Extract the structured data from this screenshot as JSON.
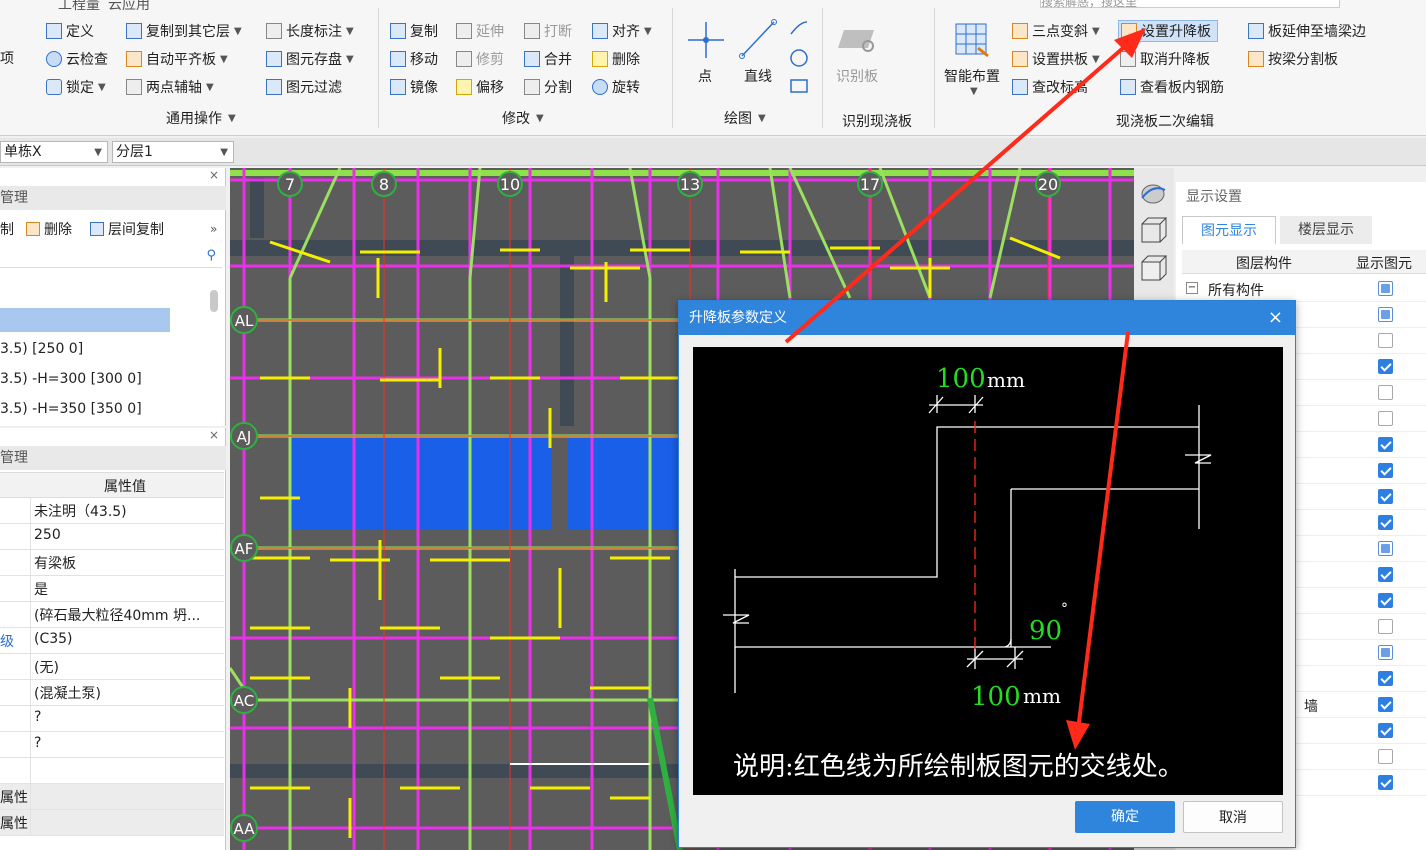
{
  "ribbon": {
    "top_tabs": [
      "工程量",
      "云应用"
    ],
    "group_general": {
      "label": "通用操作",
      "items": [
        "定义",
        "复制到其它层",
        "长度标注",
        "云检查",
        "自动平齐板",
        "图元存盘",
        "锁定",
        "两点辅轴",
        "图元过滤"
      ]
    },
    "group_modify": {
      "label": "修改",
      "items": [
        "复制",
        "延伸",
        "打断",
        "对齐",
        "移动",
        "修剪",
        "合并",
        "删除",
        "镜像",
        "偏移",
        "分割",
        "旋转"
      ]
    },
    "group_draw": {
      "label": "绘图",
      "items": [
        "点",
        "直线"
      ]
    },
    "group_identify": {
      "label": "识别现浇板",
      "items": [
        "识别板"
      ]
    },
    "group_slab": {
      "label": "现浇板二次编辑",
      "items": [
        "智能布置",
        "三点变斜",
        "设置拱板",
        "查改标高",
        "设置升降板",
        "取消升降板",
        "查看板内钢筋",
        "板延伸至墙梁边",
        "按梁分割板"
      ]
    },
    "left_edge_label": "项",
    "search_placeholder": "搜索解惑，搜这里"
  },
  "toolbar2": {
    "combo1": "单栋X",
    "combo2": "分层1"
  },
  "left_panel_top": {
    "title": "管理",
    "actions": [
      "制",
      "删除",
      "层间复制"
    ],
    "list": [
      "3.5)  [250 0]",
      "3.5)  -H=300 [300 0]",
      "3.5)  -H=350 [350 0]"
    ]
  },
  "left_panel_props": {
    "title": "管理",
    "header": "属性值",
    "values": [
      "未注明（43.5)",
      "250",
      "有梁板",
      "是",
      "(碎石最大粒径40mm 坍...",
      "(C35)",
      "(无)",
      "(混凝土泵)",
      "?",
      "?",
      "",
      "",
      ""
    ],
    "row_labels": [
      "",
      "",
      "",
      "",
      "",
      "级",
      "",
      "",
      "",
      "",
      "",
      "属性",
      "属性"
    ]
  },
  "canvas": {
    "axis_top": [
      "7",
      "8",
      "10",
      "13",
      "17",
      "20"
    ],
    "axis_left": [
      "AL",
      "AJ",
      "AF",
      "AC",
      "AA"
    ]
  },
  "right_panel": {
    "title": "显示设置",
    "tabs": [
      "图元显示",
      "楼层显示"
    ],
    "col_headers": [
      "图层构件",
      "显示图元"
    ],
    "rows": [
      {
        "label": "所有构件",
        "state": "part"
      },
      {
        "label": "",
        "state": "part"
      },
      {
        "label": "",
        "state": "off"
      },
      {
        "label": "",
        "state": "on"
      },
      {
        "label": "",
        "state": "off"
      },
      {
        "label": "",
        "state": "off"
      },
      {
        "label": "",
        "state": "on"
      },
      {
        "label": "",
        "state": "on"
      },
      {
        "label": "",
        "state": "on"
      },
      {
        "label": "",
        "state": "on"
      },
      {
        "label": "",
        "state": "part"
      },
      {
        "label": "",
        "state": "on"
      },
      {
        "label": "",
        "state": "on"
      },
      {
        "label": "",
        "state": "off"
      },
      {
        "label": "",
        "state": "part"
      },
      {
        "label": "",
        "state": "on"
      },
      {
        "label": "墙",
        "state": "on"
      },
      {
        "label": "",
        "state": "on"
      },
      {
        "label": "",
        "state": "off"
      },
      {
        "label": "",
        "state": "on"
      }
    ]
  },
  "dialog": {
    "title": "升降板参数定义",
    "close": "×",
    "dim_top_value": "100",
    "dim_top_unit": "mm",
    "angle_value": "90",
    "angle_unit": "°",
    "dim_bottom_value": "100",
    "dim_bottom_unit": "mm",
    "note": "说明:红色线为所绘制板图元的交线处。",
    "ok": "确定",
    "cancel": "取消"
  },
  "colors": {
    "accent": "#2f84dc",
    "cad_bg": "#5c5c5c",
    "beam_magenta": "#e830e8",
    "rebar_yellow": "#f4f000",
    "slab_blue": "#1a5fe8",
    "axis_green": "#2fb040",
    "annotation_red": "#ff2a1a",
    "dim_green": "#22dd22"
  }
}
